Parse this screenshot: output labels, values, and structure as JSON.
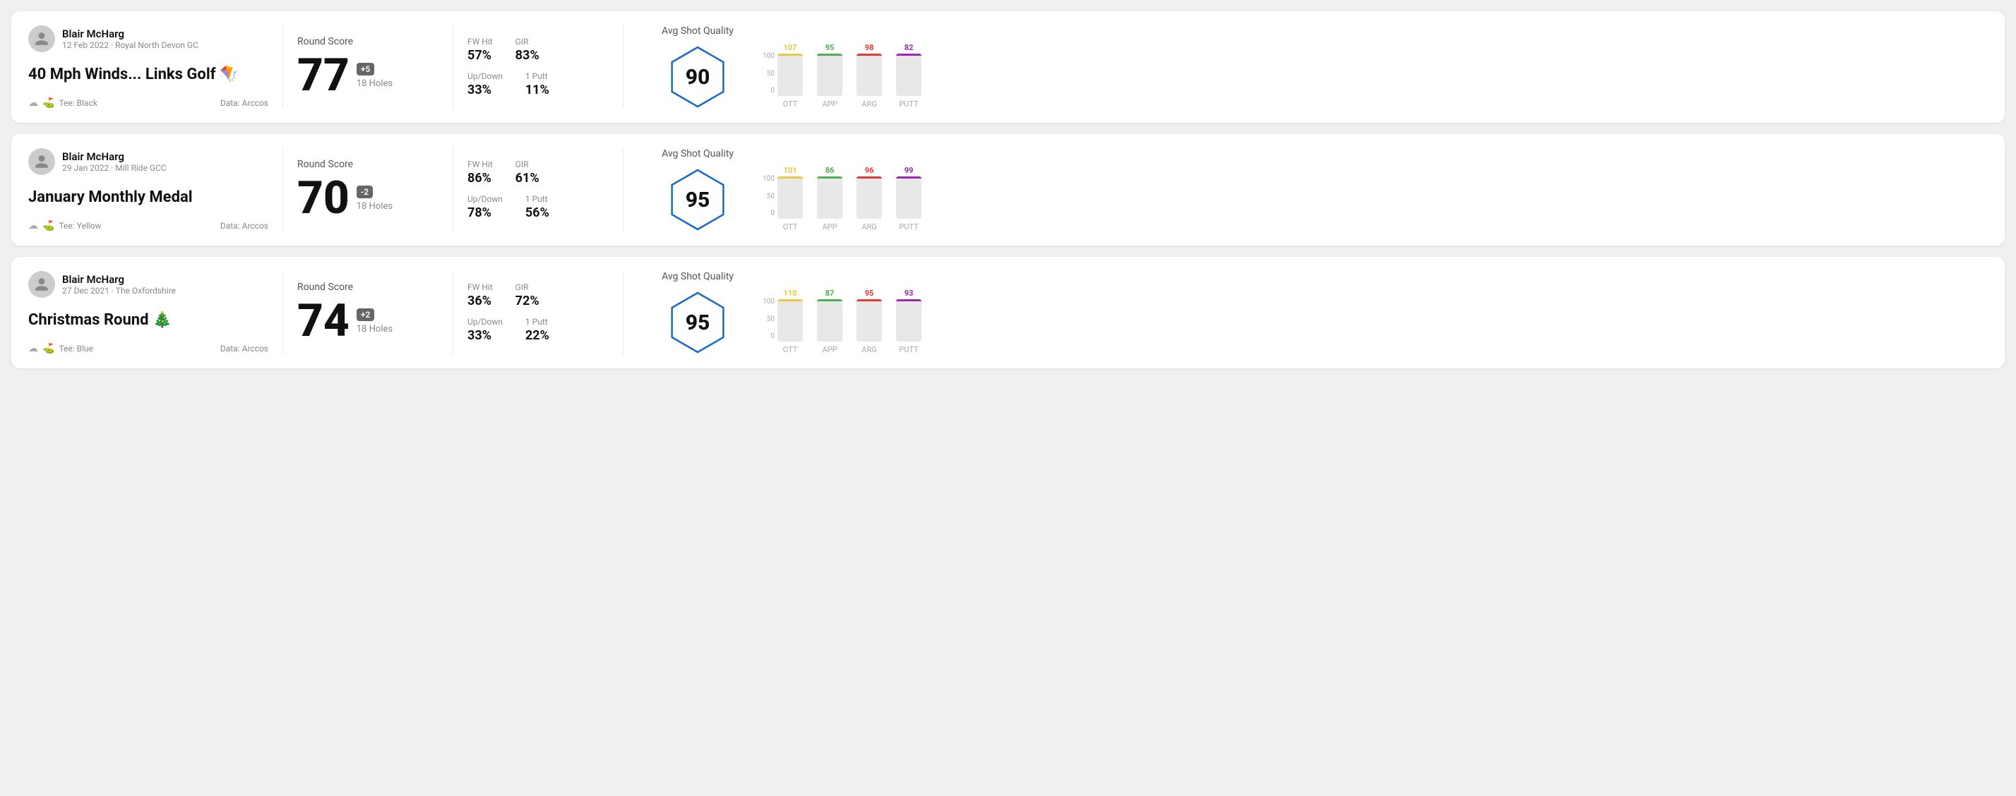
{
  "rounds": [
    {
      "id": "round1",
      "user": {
        "name": "Blair McHarg",
        "date": "12 Feb 2022 · Royal North Devon GC"
      },
      "title": "40 Mph Winds... Links Golf 🪁",
      "tee": "Black",
      "data_source": "Data: Arccos",
      "score": {
        "value": "77",
        "modifier": "+5",
        "modifier_type": "positive",
        "holes": "18 Holes"
      },
      "stats": {
        "fw_hit_label": "FW Hit",
        "fw_hit_value": "57%",
        "gir_label": "GIR",
        "gir_value": "83%",
        "updown_label": "Up/Down",
        "updown_value": "33%",
        "oneputt_label": "1 Putt",
        "oneputt_value": "11%"
      },
      "shot_quality": {
        "label": "Avg Shot Quality",
        "score": "90"
      },
      "bars": [
        {
          "label": "OTT",
          "value": 107,
          "color": "#e8c840",
          "height_pct": 85
        },
        {
          "label": "APP",
          "value": 95,
          "color": "#4caf50",
          "height_pct": 70
        },
        {
          "label": "ARG",
          "value": 98,
          "color": "#e53935",
          "height_pct": 73
        },
        {
          "label": "PUTT",
          "value": 82,
          "color": "#9c27b0",
          "height_pct": 60
        }
      ],
      "chart_max": 100
    },
    {
      "id": "round2",
      "user": {
        "name": "Blair McHarg",
        "date": "29 Jan 2022 · Mill Ride GCC"
      },
      "title": "January Monthly Medal",
      "tee": "Yellow",
      "data_source": "Data: Arccos",
      "score": {
        "value": "70",
        "modifier": "-2",
        "modifier_type": "negative",
        "holes": "18 Holes"
      },
      "stats": {
        "fw_hit_label": "FW Hit",
        "fw_hit_value": "86%",
        "gir_label": "GIR",
        "gir_value": "61%",
        "updown_label": "Up/Down",
        "updown_value": "78%",
        "oneputt_label": "1 Putt",
        "oneputt_value": "56%"
      },
      "shot_quality": {
        "label": "Avg Shot Quality",
        "score": "95"
      },
      "bars": [
        {
          "label": "OTT",
          "value": 101,
          "color": "#e8c840",
          "height_pct": 80
        },
        {
          "label": "APP",
          "value": 86,
          "color": "#4caf50",
          "height_pct": 63
        },
        {
          "label": "ARG",
          "value": 96,
          "color": "#e53935",
          "height_pct": 73
        },
        {
          "label": "PUTT",
          "value": 99,
          "color": "#9c27b0",
          "height_pct": 76
        }
      ],
      "chart_max": 100
    },
    {
      "id": "round3",
      "user": {
        "name": "Blair McHarg",
        "date": "27 Dec 2021 · The Oxfordshire"
      },
      "title": "Christmas Round 🎄",
      "tee": "Blue",
      "data_source": "Data: Arccos",
      "score": {
        "value": "74",
        "modifier": "+2",
        "modifier_type": "positive",
        "holes": "18 Holes"
      },
      "stats": {
        "fw_hit_label": "FW Hit",
        "fw_hit_value": "36%",
        "gir_label": "GIR",
        "gir_value": "72%",
        "updown_label": "Up/Down",
        "updown_value": "33%",
        "oneputt_label": "1 Putt",
        "oneputt_value": "22%"
      },
      "shot_quality": {
        "label": "Avg Shot Quality",
        "score": "95"
      },
      "bars": [
        {
          "label": "OTT",
          "value": 110,
          "color": "#e8c840",
          "height_pct": 88
        },
        {
          "label": "APP",
          "value": 87,
          "color": "#4caf50",
          "height_pct": 64
        },
        {
          "label": "ARG",
          "value": 95,
          "color": "#e53935",
          "height_pct": 72
        },
        {
          "label": "PUTT",
          "value": 93,
          "color": "#9c27b0",
          "height_pct": 71
        }
      ],
      "chart_max": 100
    }
  ],
  "labels": {
    "round_score": "Round Score",
    "avg_shot_quality": "Avg Shot Quality",
    "fw_hit": "FW Hit",
    "gir": "GIR",
    "up_down": "Up/Down",
    "one_putt": "1 Putt",
    "tee_prefix": "Tee:",
    "y_axis_100": "100",
    "y_axis_50": "50",
    "y_axis_0": "0"
  }
}
